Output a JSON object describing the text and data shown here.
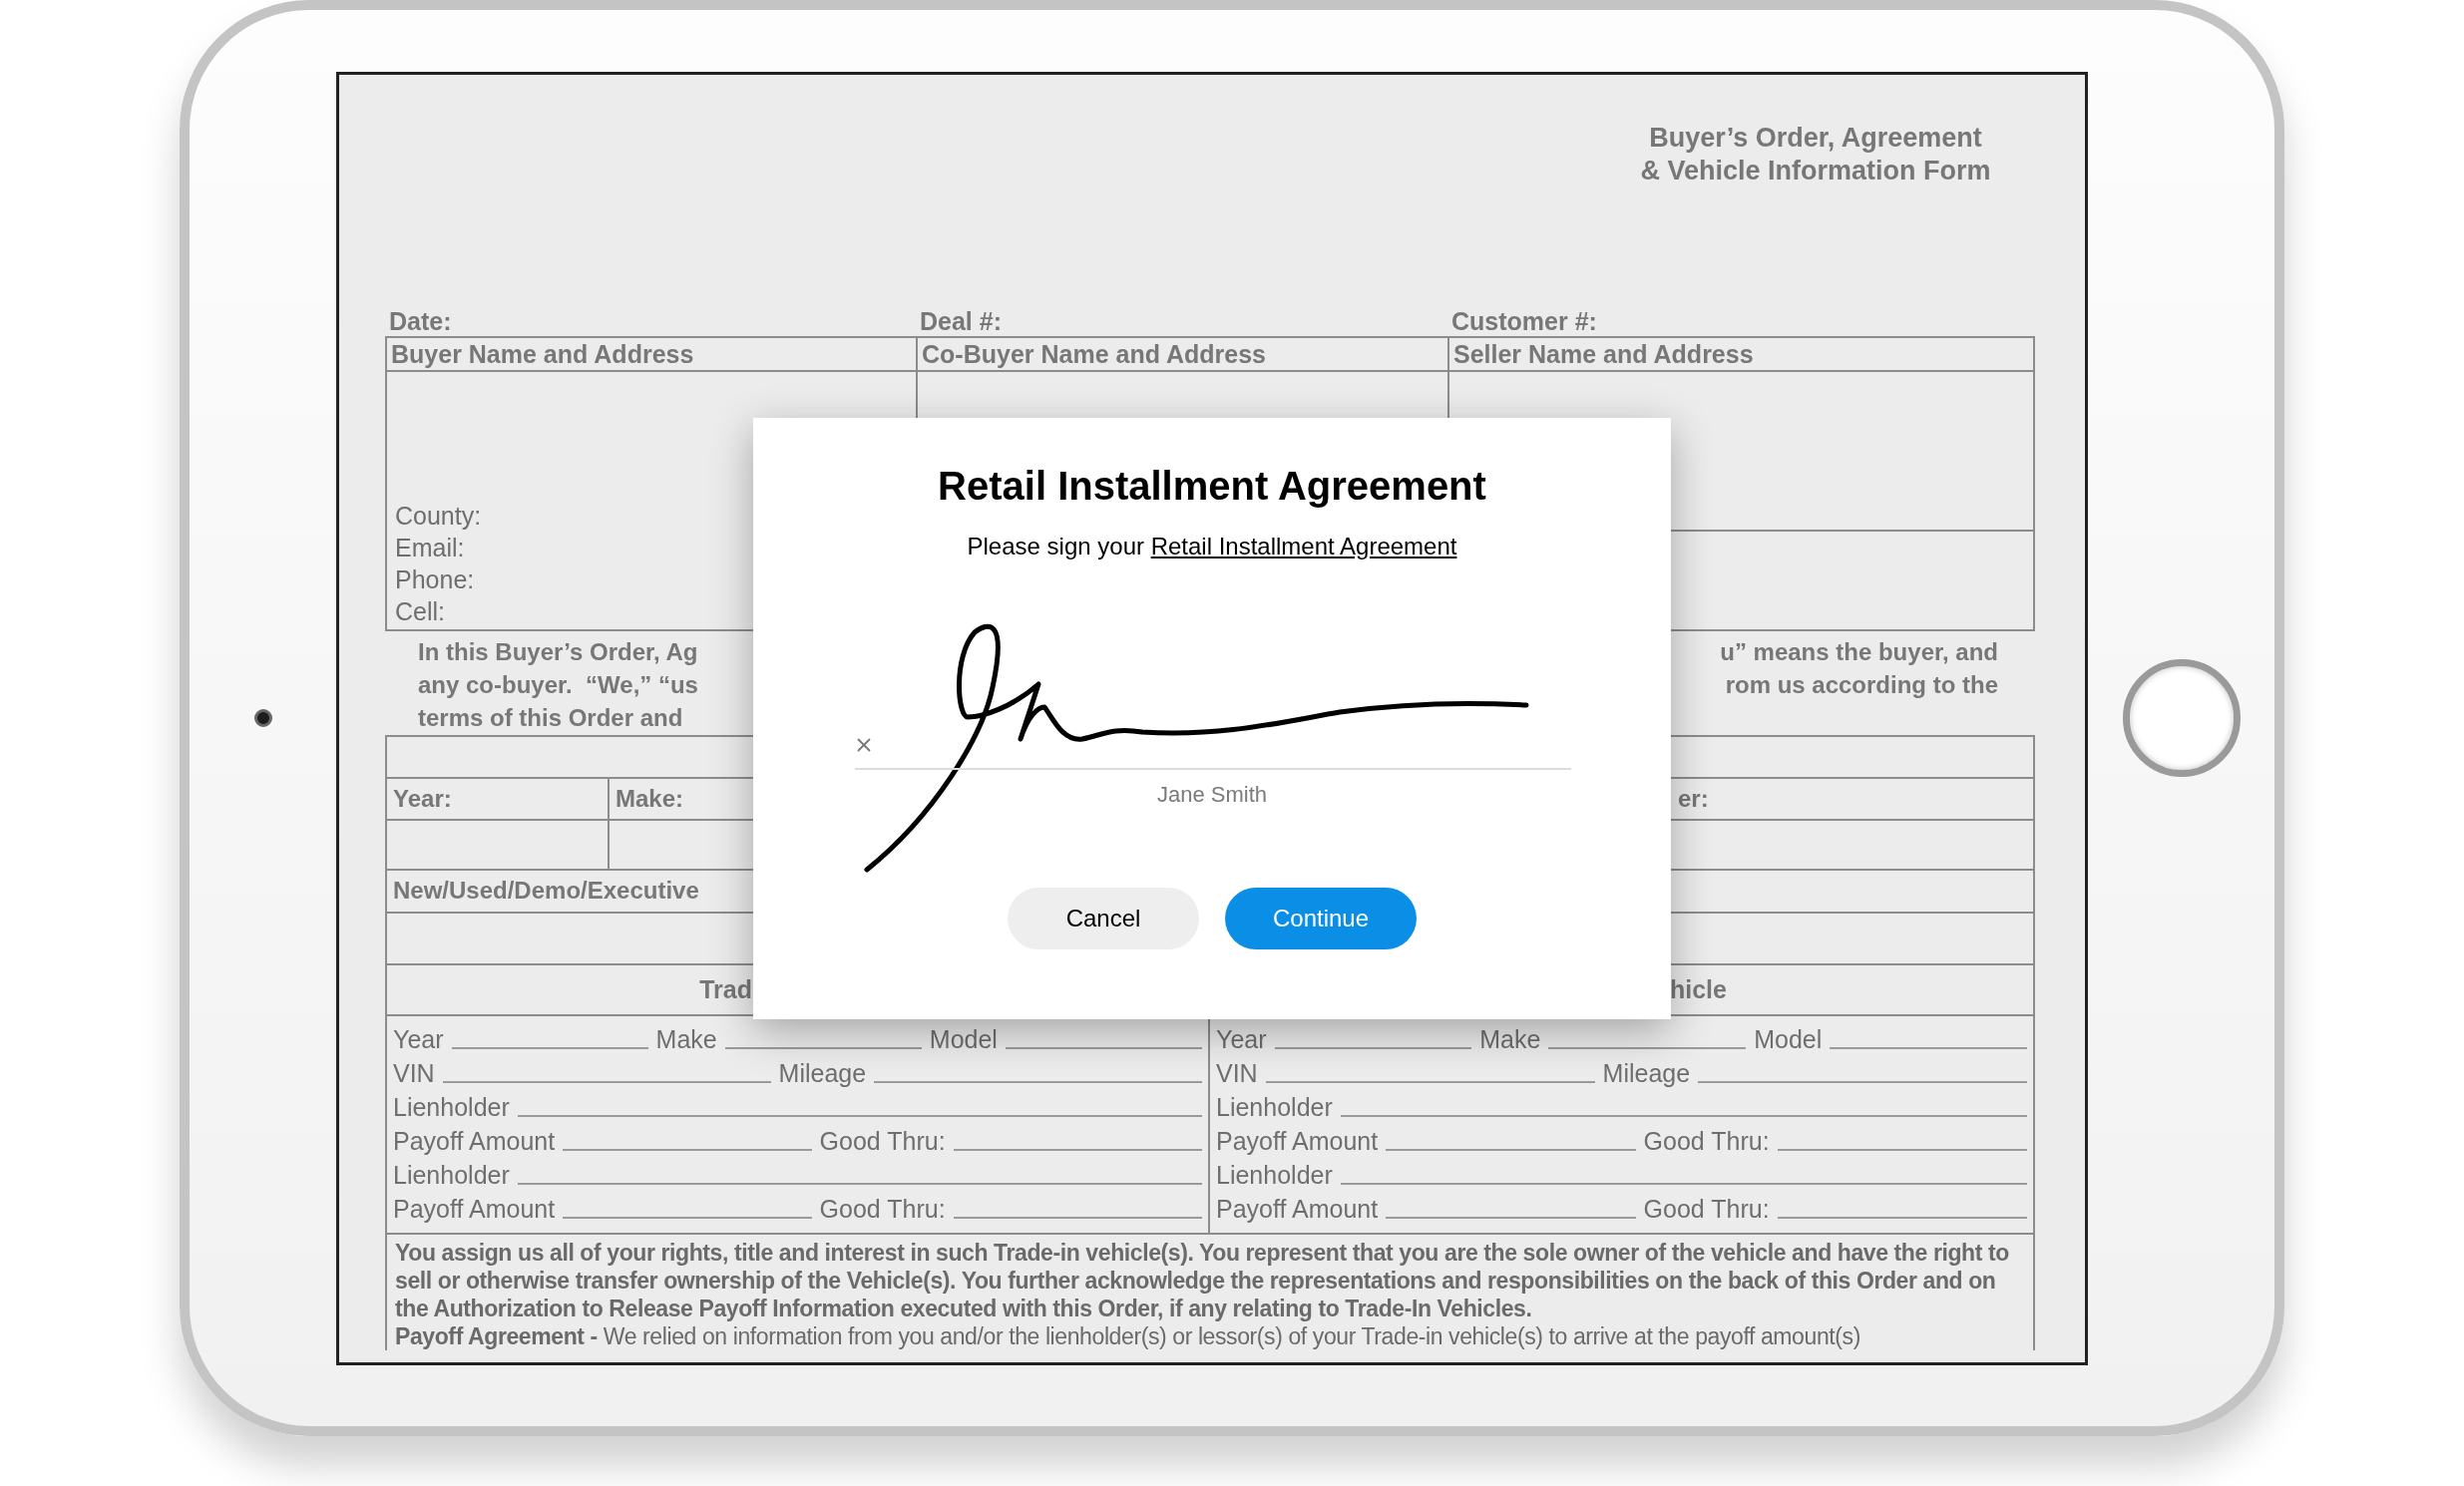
{
  "form": {
    "title_lines": [
      "Buyer’s Order, Agreement",
      "& Vehicle Information Form"
    ],
    "header_fields": [
      "Date:",
      "Deal #:",
      "Customer #:"
    ],
    "party_columns": [
      "Buyer Name and Address",
      "Co-Buyer Name and Address",
      "Seller Name and Address"
    ],
    "buyer_contact_fields": [
      "County:",
      "Email:",
      "Phone:",
      "Cell:"
    ],
    "intro_left_lines": [
      "In this Buyer’s Order, Ag",
      "any co-buyer.  “We,” “us",
      "terms of this Order and"
    ],
    "intro_right_lines": [
      "u” means the buyer, and",
      "rom us according to the"
    ],
    "vehicle_labels_left": [
      "Year:",
      "Make:"
    ],
    "vehicle_label_right": "er:",
    "type_label": "New/Used/Demo/Executive",
    "trade_in_heading_left": "Trad",
    "trade_in_heading_right": "hicle",
    "trade_in_columns": [
      {
        "lines": [
          {
            "fields": [
              "Year",
              "Make",
              "Model"
            ]
          },
          {
            "fields": [
              "VIN",
              "Mileage"
            ]
          },
          {
            "fields": [
              "Lienholder"
            ]
          },
          {
            "fields": [
              "Payoff Amount",
              "Good Thru:"
            ]
          },
          {
            "fields": [
              "Lienholder"
            ]
          },
          {
            "fields": [
              "Payoff Amount",
              "Good Thru:"
            ]
          }
        ]
      },
      {
        "lines": [
          {
            "fields": [
              "Year",
              "Make",
              "Model"
            ]
          },
          {
            "fields": [
              "VIN",
              "Mileage"
            ]
          },
          {
            "fields": [
              "Lienholder"
            ]
          },
          {
            "fields": [
              "Payoff Amount",
              "Good Thru:"
            ]
          },
          {
            "fields": [
              "Lienholder"
            ]
          },
          {
            "fields": [
              "Payoff Amount",
              "Good Thru:"
            ]
          }
        ]
      }
    ],
    "assignment_text": "You assign us all of your rights, title and interest in such Trade-in vehicle(s).  You represent that you are the sole owner of the vehicle and have the right to sell or otherwise transfer ownership of the Vehicle(s). You further acknowledge the representations and responsibilities on the back of this Order and on the Authorization to Release Payoff Information executed with this Order, if any relating to Trade-In Vehicles.",
    "payoff_text": "**Payoff Agreement -** We relied on information from you and/or the lienholder(s) or lessor(s) of your Trade-in vehicle(s) to arrive at the payoff amount(s)"
  },
  "dialog": {
    "title": "Retail Installment Agreement",
    "prompt": "Please sign your",
    "link": "Retail Installment Agreement",
    "signer_name": "Jane Smith",
    "buttons": [
      {
        "label": "Cancel",
        "kind": "secondary"
      },
      {
        "label": "Continue",
        "kind": "primary"
      }
    ]
  }
}
